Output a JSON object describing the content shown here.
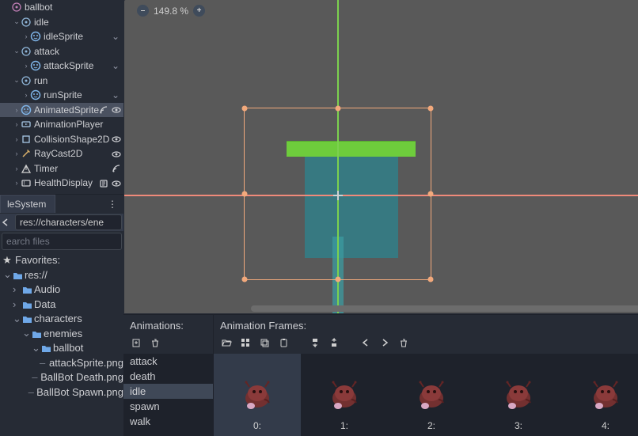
{
  "zoom": {
    "value": "149.8 %"
  },
  "scene_tree": {
    "nodes": [
      {
        "name": "ballbot",
        "indent": 0,
        "icon": "root",
        "expanded": true,
        "vis": false,
        "sig": false,
        "script": false,
        "chev": false
      },
      {
        "name": "idle",
        "indent": 1,
        "icon": "node2d",
        "expanded": true,
        "vis": false,
        "sig": false,
        "script": false
      },
      {
        "name": "idleSprite",
        "indent": 2,
        "icon": "sprite",
        "expanded": false,
        "vis": false,
        "sig": false,
        "script": false,
        "collapse": true
      },
      {
        "name": "attack",
        "indent": 1,
        "icon": "node2d",
        "expanded": true,
        "vis": false,
        "sig": false,
        "script": false
      },
      {
        "name": "attackSprite",
        "indent": 2,
        "icon": "sprite",
        "expanded": false,
        "vis": false,
        "sig": false,
        "script": false,
        "collapse": true
      },
      {
        "name": "run",
        "indent": 1,
        "icon": "node2d",
        "expanded": true,
        "vis": false,
        "sig": false,
        "script": false
      },
      {
        "name": "runSprite",
        "indent": 2,
        "icon": "sprite",
        "expanded": false,
        "vis": false,
        "sig": false,
        "script": false,
        "collapse": true
      },
      {
        "name": "AnimatedSprite",
        "indent": 1,
        "icon": "sprite",
        "expanded": false,
        "vis": true,
        "sig": true,
        "script": false,
        "selected": true
      },
      {
        "name": "AnimationPlayer",
        "indent": 1,
        "icon": "anim",
        "expanded": false,
        "vis": false,
        "sig": false,
        "script": false
      },
      {
        "name": "CollisionShape2D",
        "indent": 1,
        "icon": "shape",
        "expanded": false,
        "vis": true,
        "sig": false,
        "script": false
      },
      {
        "name": "RayCast2D",
        "indent": 1,
        "icon": "ray",
        "expanded": false,
        "vis": true,
        "sig": false,
        "script": false
      },
      {
        "name": "Timer",
        "indent": 1,
        "icon": "timer",
        "expanded": false,
        "vis": false,
        "sig": true,
        "script": false
      },
      {
        "name": "HealthDisplay",
        "indent": 1,
        "icon": "script",
        "expanded": false,
        "vis": true,
        "sig": false,
        "script": true
      }
    ]
  },
  "filesystem": {
    "tab_label": "leSystem",
    "path_value": "res://characters/ene",
    "filter_placeholder": "earch files",
    "favorites_label": "Favorites:",
    "items": [
      {
        "name": "res://",
        "type": "folder",
        "indent": 0,
        "expanded": true
      },
      {
        "name": "Audio",
        "type": "folder",
        "indent": 1,
        "expanded": false
      },
      {
        "name": "Data",
        "type": "folder",
        "indent": 1,
        "expanded": false
      },
      {
        "name": "characters",
        "type": "folder",
        "indent": 1,
        "expanded": true
      },
      {
        "name": "enemies",
        "type": "folder",
        "indent": 2,
        "expanded": true
      },
      {
        "name": "ballbot",
        "type": "folder",
        "indent": 3,
        "expanded": true
      },
      {
        "name": "attackSprite.png",
        "type": "file",
        "indent": 4
      },
      {
        "name": "BallBot Death.png",
        "type": "file",
        "indent": 4
      },
      {
        "name": "BallBot Spawn.png",
        "type": "file",
        "indent": 4
      }
    ]
  },
  "bottom": {
    "anim_label": "Animations:",
    "frames_label": "Animation Frames:",
    "animations": [
      {
        "name": "attack"
      },
      {
        "name": "death"
      },
      {
        "name": "idle",
        "selected": true
      },
      {
        "name": "spawn"
      },
      {
        "name": "walk"
      }
    ],
    "frames": [
      {
        "label": "0:",
        "selected": true
      },
      {
        "label": "1:"
      },
      {
        "label": "2:"
      },
      {
        "label": "3:"
      },
      {
        "label": "4:"
      }
    ]
  }
}
